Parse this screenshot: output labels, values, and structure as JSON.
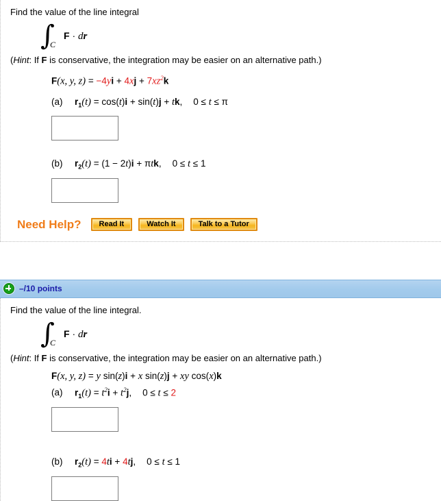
{
  "problems": [
    {
      "prompt": "Find the value of the line integral",
      "integral": {
        "sign": "∫",
        "subscript": "C",
        "body_bold": "F",
        "body_dot": "·",
        "body_dr": "dр"
      },
      "hint_open": "(",
      "hint_word": "Hint",
      "hint_colon": ": If ",
      "hint_bold": "F",
      "hint_rest": " is conservative, the integration may be easier on an alternative path.)",
      "field_label": "F(x, y, z) = ",
      "field_terms": [
        {
          "coef": "−4",
          "coef_color": "red",
          "var": "y",
          "basis": "i"
        },
        {
          "coef": "4",
          "coef_color": "red",
          "var": "x",
          "basis": "j"
        },
        {
          "coef": "7",
          "coef_color": "red",
          "var": "xz",
          "exp": "2",
          "basis": "k"
        }
      ],
      "parts": [
        {
          "label": "(a)",
          "vector_name": "r",
          "vector_sub": "1",
          "paren_t": "(t) = ",
          "expr": "cos(t)i + sin(t)j + tk,",
          "domain": "0 ≤ t ≤ π",
          "answer_value": "",
          "answer_placeholder": ""
        },
        {
          "label": "(b)",
          "vector_name": "r",
          "vector_sub": "2",
          "paren_t": "(t) = ",
          "expr": "(1 − 2t)i + πtk,",
          "domain": "0 ≤ t ≤ 1",
          "answer_value": "",
          "answer_placeholder": ""
        }
      ],
      "need_help": {
        "label": "Need Help?",
        "buttons": [
          {
            "label": "Read It",
            "name": "read-it-button"
          },
          {
            "label": "Watch It",
            "name": "watch-it-button"
          },
          {
            "label": "Talk to a Tutor",
            "name": "talk-to-a-tutor-button"
          }
        ]
      },
      "has_points_bar": false
    },
    {
      "points_bar": {
        "icon": "plus-circle-icon",
        "text": "–/10 points",
        "bg_color": "#a3cbec",
        "text_color": "#1a1aa8",
        "icon_color": "#17a01a"
      },
      "prompt": "Find the value of the line integral.",
      "integral": {
        "sign": "∫",
        "subscript": "C",
        "body_bold": "F",
        "body_dot": "·",
        "body_dr": "dр"
      },
      "hint_open": "(",
      "hint_word": "Hint",
      "hint_colon": ": If ",
      "hint_bold": "F",
      "hint_rest": " is conservative, the integration may be easier on an alternative path.)",
      "field_label": "F(x, y, z) = ",
      "field_plain": "y sin(z)i + x sin(z)j + xy cos(x)k",
      "parts": [
        {
          "label": "(a)",
          "vector_name": "r",
          "vector_sub": "1",
          "paren_t": "(t) = ",
          "expr": "t²i + t²j,",
          "domain_black": "0 ≤ t ≤ ",
          "domain_red": "2",
          "answer_value": "",
          "answer_placeholder": ""
        },
        {
          "label": "(b)",
          "vector_name": "r",
          "vector_sub": "2",
          "paren_t": "(t) = ",
          "expr_red1": "4",
          "expr_mid1": "ti + ",
          "expr_red2": "4",
          "expr_mid2": "tj,",
          "domain": "0 ≤ t ≤ 1",
          "answer_value": "",
          "answer_placeholder": ""
        }
      ],
      "has_points_bar": true
    }
  ]
}
